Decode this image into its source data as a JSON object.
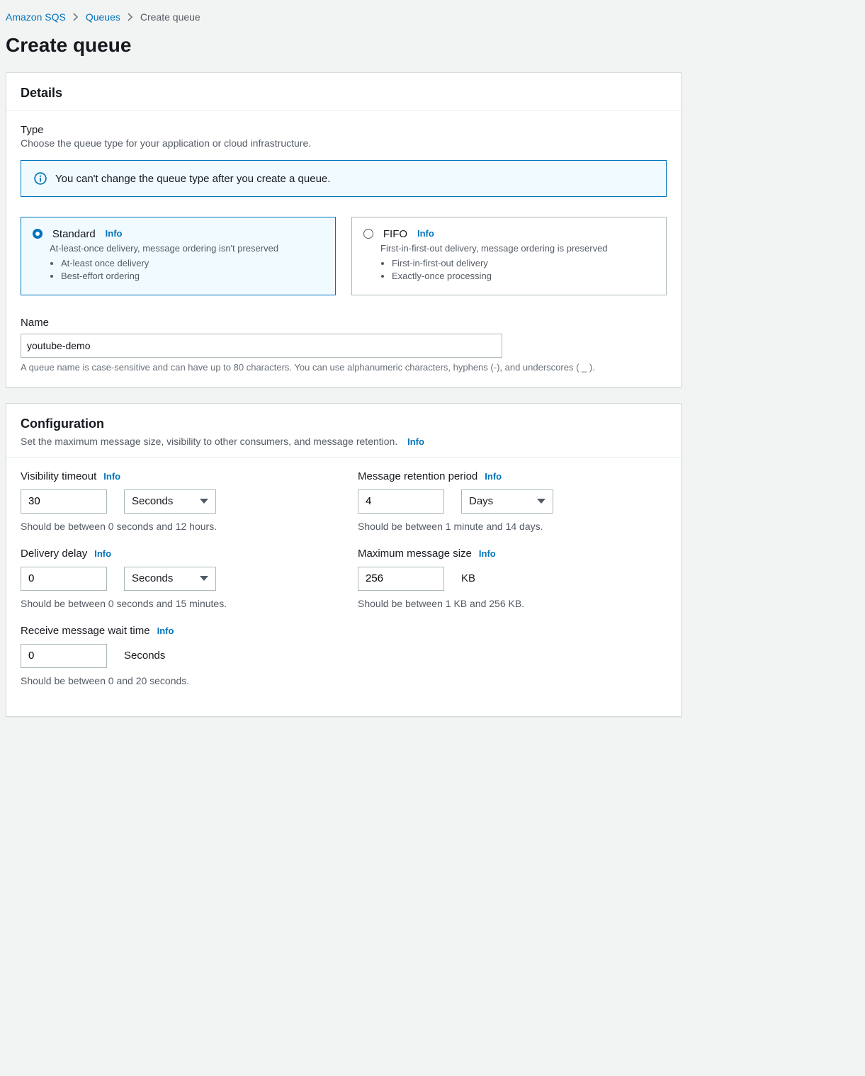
{
  "breadcrumb": {
    "root": "Amazon SQS",
    "queues": "Queues",
    "current": "Create queue"
  },
  "page_title": "Create queue",
  "details": {
    "heading": "Details",
    "type_label": "Type",
    "type_desc": "Choose the queue type for your application or cloud infrastructure.",
    "alert": "You can't change the queue type after you create a queue.",
    "standard": {
      "title": "Standard",
      "info": "Info",
      "sub": "At-least-once delivery, message ordering isn't preserved",
      "b1": "At-least once delivery",
      "b2": "Best-effort ordering"
    },
    "fifo": {
      "title": "FIFO",
      "info": "Info",
      "sub": "First-in-first-out delivery, message ordering is preserved",
      "b1": "First-in-first-out delivery",
      "b2": "Exactly-once processing"
    },
    "name_label": "Name",
    "name_value": "youtube-demo",
    "name_hint": "A queue name is case-sensitive and can have up to 80 characters. You can use alphanumeric characters, hyphens (-), and underscores ( _ )."
  },
  "config": {
    "heading": "Configuration",
    "sub": "Set the maximum message size, visibility to other consumers, and message retention.",
    "info": "Info",
    "visibility": {
      "label": "Visibility timeout",
      "info": "Info",
      "value": "30",
      "unit": "Seconds",
      "hint": "Should be between 0 seconds and 12 hours."
    },
    "retention": {
      "label": "Message retention period",
      "info": "Info",
      "value": "4",
      "unit": "Days",
      "hint": "Should be between 1 minute and 14 days."
    },
    "delay": {
      "label": "Delivery delay",
      "info": "Info",
      "value": "0",
      "unit": "Seconds",
      "hint": "Should be between 0 seconds and 15 minutes."
    },
    "maxsize": {
      "label": "Maximum message size",
      "info": "Info",
      "value": "256",
      "unit": "KB",
      "hint": "Should be between 1 KB and 256 KB."
    },
    "receive_wait": {
      "label": "Receive message wait time",
      "info": "Info",
      "value": "0",
      "unit": "Seconds",
      "hint": "Should be between 0 and 20 seconds."
    }
  }
}
